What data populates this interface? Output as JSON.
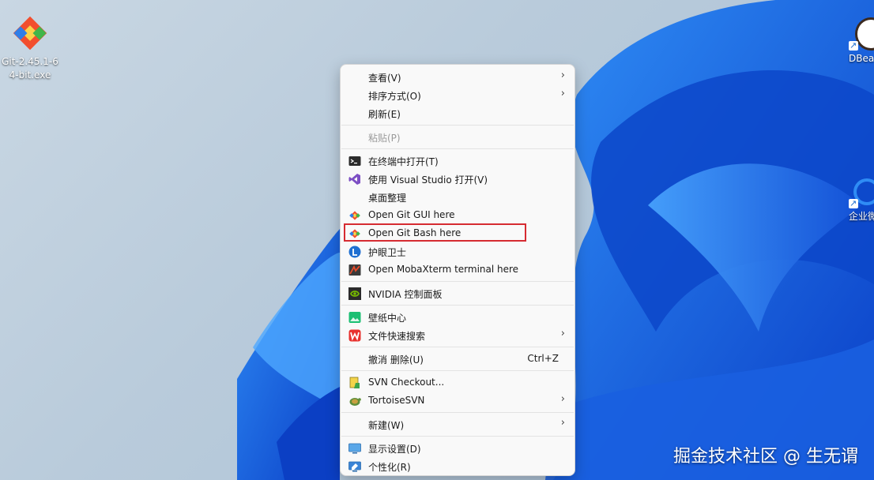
{
  "desktop": {
    "icons": [
      {
        "label_line1": "Git-2.45.1-6",
        "label_line2": "4-bit.exe"
      },
      {
        "label": "DBea"
      },
      {
        "label": "企业微"
      }
    ]
  },
  "menu": {
    "items": [
      {
        "label": "查看(V)",
        "has_submenu": true
      },
      {
        "label": "排序方式(O)",
        "has_submenu": true
      },
      {
        "label": "刷新(E)"
      },
      {
        "label": "粘贴(P)",
        "disabled": true
      },
      {
        "label": "在终端中打开(T)",
        "icon": "terminal-icon"
      },
      {
        "label": "使用 Visual Studio 打开(V)",
        "icon": "visual-studio-icon"
      },
      {
        "label": "桌面整理"
      },
      {
        "label": "Open Git GUI here",
        "icon": "git-icon"
      },
      {
        "label": "Open Git Bash here",
        "icon": "git-icon",
        "highlighted": true
      },
      {
        "label": "护眼卫士",
        "icon": "eye-guard-icon"
      },
      {
        "label": "Open MobaXterm terminal here",
        "icon": "mobaxterm-icon"
      },
      {
        "label": "NVIDIA 控制面板",
        "icon": "nvidia-icon"
      },
      {
        "label": "壁纸中心",
        "icon": "wallpaper-icon"
      },
      {
        "label": "文件快速搜索",
        "icon": "wps-icon",
        "has_submenu": true
      },
      {
        "label": "撤消 删除(U)",
        "shortcut": "Ctrl+Z"
      },
      {
        "label": "SVN Checkout...",
        "icon": "svn-checkout-icon"
      },
      {
        "label": "TortoiseSVN",
        "icon": "tortoisesvn-icon",
        "has_submenu": true
      },
      {
        "label": "新建(W)",
        "has_submenu": true
      },
      {
        "label": "显示设置(D)",
        "icon": "display-icon"
      },
      {
        "label": "个性化(R)",
        "icon": "personalize-icon"
      }
    ],
    "submenu_arrow": "›"
  },
  "watermark": {
    "text": "掘金技术社区 @ 生无谓"
  },
  "colors": {
    "highlight_border": "#d62b31",
    "menu_bg": "#f9f9f9"
  }
}
